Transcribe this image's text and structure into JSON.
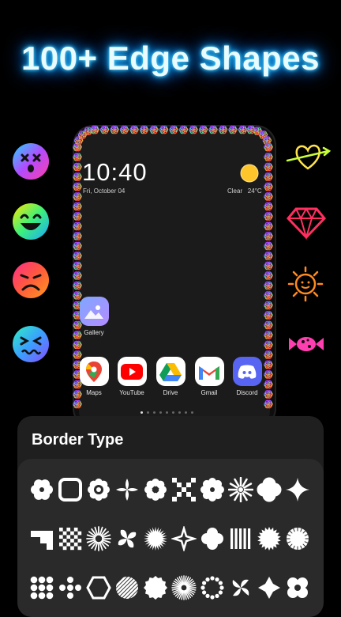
{
  "headline": "100+ Edge Shapes",
  "left_stickers": [
    "dizzy-face-icon",
    "grinning-face-icon",
    "crying-face-icon",
    "nauseated-face-icon"
  ],
  "right_stickers": [
    "heart-arrow-icon",
    "diamond-icon",
    "sun-icon",
    "candy-icon"
  ],
  "lockscreen": {
    "time": "10:40",
    "date": "Fri, October 04",
    "weather_condition": "Clear",
    "weather_temp": "24°C"
  },
  "apps": {
    "gallery": "Gallery",
    "dock": [
      "Maps",
      "YouTube",
      "Drive",
      "Gmail",
      "Discord"
    ]
  },
  "page_indicator": {
    "count": 9,
    "active_index": 0
  },
  "sheet": {
    "title": "Border Type"
  },
  "border_types": [
    "flower-6",
    "rounded-square",
    "mandala",
    "pinwheel-4",
    "flower-8",
    "diagonal-x",
    "gear-flower",
    "star-burst",
    "clover-4",
    "spark-4",
    "stairs",
    "checker",
    "sunburst",
    "fan-4",
    "starburst-fine",
    "diamond-4",
    "clover-round",
    "stripes-grid",
    "burst-large",
    "sun-rays",
    "dots-grid",
    "cross-dots",
    "hexagon",
    "stripe-circle",
    "wavy-circle",
    "sun-dense",
    "dotted-ring",
    "swirl",
    "dot-star",
    "four-circles"
  ],
  "colors": {
    "background": "#000000",
    "headline_glow": "#19b4ff",
    "sheet_bg": "#1f1f1f",
    "panel_bg": "#2a2a2a"
  }
}
